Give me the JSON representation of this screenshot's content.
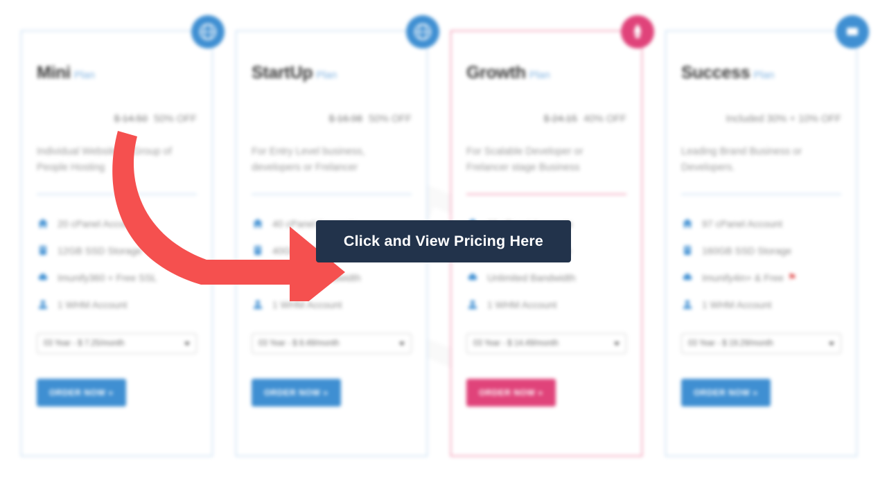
{
  "callout": {
    "text": "Click and View Pricing Here",
    "background_color": "#22334b",
    "text_color": "#ffffff",
    "arrow_color": "#f5504f"
  },
  "theme": {
    "accent_blue": "#3f8fd2",
    "accent_pink": "#e0437a",
    "border_blue": "#aaccec",
    "border_pink": "#e8547f",
    "muted_text": "#9a9a9a"
  },
  "plans": [
    {
      "name": "Mini",
      "plan_word": "Plan",
      "badge_icon": "globe-badge-icon",
      "accent": "blue",
      "price_old": "$ 14.50",
      "discount": "50% OFF",
      "description": "Individual Website or Group of People Hosting",
      "features": [
        {
          "icon": "cpanel-home-icon",
          "label": "20 cPanel Accounts"
        },
        {
          "icon": "database-storage-icon",
          "label": "12GB SSD Storage"
        },
        {
          "icon": "shield-cloud-icon",
          "label": "Imunify360 + Free SSL"
        },
        {
          "icon": "user-account-icon",
          "label": "1 WHM Account"
        }
      ],
      "term_select": "03 Year - $ 7.25/month",
      "order_label": "ORDER NOW »"
    },
    {
      "name": "StartUp",
      "plan_word": "Plan",
      "badge_icon": "globe-badge-icon",
      "accent": "blue",
      "price_old": "$ 16.98",
      "discount": "50% OFF",
      "description": "For Entry Level business, developers or Frelancer",
      "features": [
        {
          "icon": "cpanel-home-icon",
          "label": "40 cPanel Accounts"
        },
        {
          "icon": "database-storage-icon",
          "label": "40GB SSD Storage"
        },
        {
          "icon": "shield-cloud-icon",
          "label": "Unlimited Bandwidth"
        },
        {
          "icon": "user-account-icon",
          "label": "1 WHM Account"
        }
      ],
      "term_select": "03 Year - $ 8.49/month",
      "order_label": "ORDER NOW »"
    },
    {
      "name": "Growth",
      "plan_word": "Plan",
      "badge_icon": "rocket-badge-icon",
      "accent": "pink",
      "price_old": "$ 24.15",
      "discount": "40% OFF",
      "description": "For Scalable Developer or Frelancer stage Business",
      "features": [
        {
          "icon": "cpanel-home-icon",
          "label": "60 cPanel Accounts"
        },
        {
          "icon": "database-storage-icon",
          "label": "80GB SSD Storage"
        },
        {
          "icon": "shield-cloud-icon",
          "label": "Unlimited Bandwidth"
        },
        {
          "icon": "user-account-icon",
          "label": "1 WHM Account"
        }
      ],
      "term_select": "03 Year - $ 14.49/month",
      "order_label": "ORDER NOW »"
    },
    {
      "name": "Success",
      "plan_word": "Plan",
      "badge_icon": "flag-badge-icon",
      "accent": "blue",
      "price_old": "",
      "discount": "Included 30% + 10% OFF",
      "description": "Leading Brand Business or Developers.",
      "features": [
        {
          "icon": "cpanel-home-icon",
          "label": "97 cPanel Account"
        },
        {
          "icon": "database-storage-icon",
          "label": "160GB SSD Storage"
        },
        {
          "icon": "shield-cloud-icon",
          "label": "Imunify4in+ & Free",
          "flag": "⚑"
        },
        {
          "icon": "user-account-icon",
          "label": "1 WHM Account"
        }
      ],
      "term_select": "03 Year - $ 19.29/month",
      "order_label": "ORDER NOW »"
    }
  ]
}
